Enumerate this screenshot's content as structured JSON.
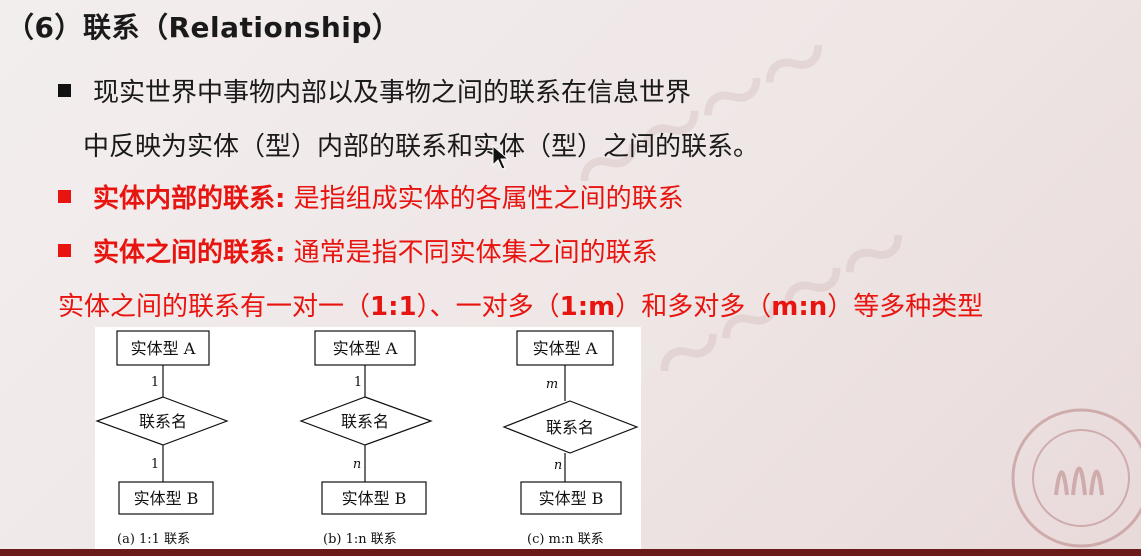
{
  "slide": {
    "title": "（6）联系（Relationship）",
    "bullet1_line1": "现实世界中事物内部以及事物之间的联系在信息世界",
    "bullet1_line2": "中反映为实体（型）内部的联系和实体（型）之间的联系。",
    "bullet2_term": "实体内部的联系:",
    "bullet2_text": " 是指组成实体的各属性之间的联系",
    "bullet3_term": "实体之间的联系:",
    "bullet3_text": " 通常是指不同实体集之间的联系",
    "types_line_a": "实体之间的联系有一对一（",
    "types_ratio1": "1:1",
    "types_line_b": "）、一对多（",
    "types_ratio2": "1:m",
    "types_line_c": "）和多对多（",
    "types_ratio3": "m:n",
    "types_line_d": "）等多种类型"
  },
  "figure": {
    "diagrams": [
      {
        "entity_a": "实体型 A",
        "relation": "联系名",
        "entity_b": "实体型 B",
        "card_top": "1",
        "card_bottom": "1",
        "caption": "(a)  1:1 联系"
      },
      {
        "entity_a": "实体型 A",
        "relation": "联系名",
        "entity_b": "实体型 B",
        "card_top": "1",
        "card_bottom": "n",
        "caption": "(b)  1:n 联系"
      },
      {
        "entity_a": "实体型 A",
        "relation": "联系名",
        "entity_b": "实体型 B",
        "card_top": "m",
        "card_bottom": "n",
        "caption": "(c)  m:n 联系"
      }
    ]
  },
  "colors": {
    "accent_red": "#e8140f",
    "text": "#1a1a1a",
    "bottom_bar": "#6b1a1a"
  },
  "icons": {
    "bullet": "black-square-bullet",
    "red_bullet": "red-square-bullet",
    "cursor": "mouse-pointer-icon",
    "seal": "university-seal-icon"
  }
}
